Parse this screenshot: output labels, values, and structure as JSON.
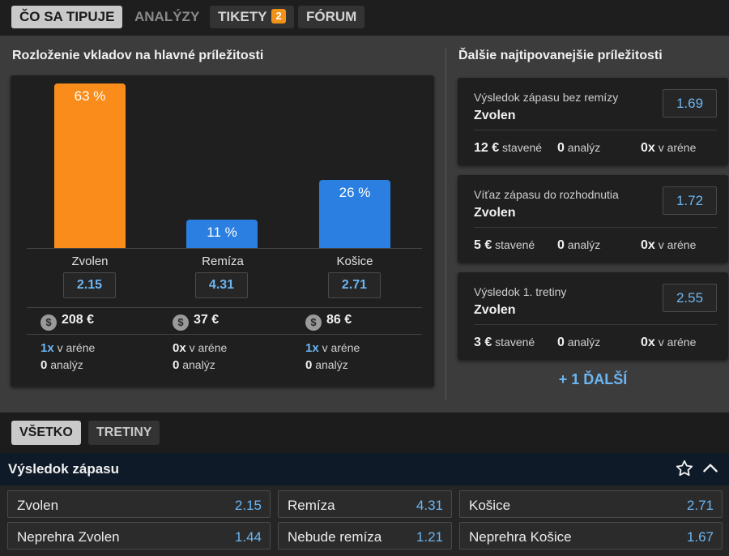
{
  "tabs": [
    {
      "label": "ČO SA TIPUJE"
    },
    {
      "label": "ANALÝZY"
    },
    {
      "label": "TIKETY",
      "badge": "2"
    },
    {
      "label": "FÓRUM"
    }
  ],
  "left_title": "Rozloženie vkladov na hlavné príležitosti",
  "right_title": "Ďalšie najtipovanejšie príležitosti",
  "distribution": [
    {
      "percent_label": "63 %",
      "percent": 63,
      "name": "Zvolen",
      "odds": "2.15",
      "stake": "208 €",
      "arena_count": "1x",
      "arena_label": "v aréne",
      "analyses_count": "0",
      "analyses_label": "analýz",
      "color": "#f98c1a"
    },
    {
      "percent_label": "11 %",
      "percent": 11,
      "name": "Remíza",
      "odds": "4.31",
      "stake": "37 €",
      "arena_count": "0x",
      "arena_label": "v aréne",
      "analyses_count": "0",
      "analyses_label": "analýz",
      "color": "#2a7fe0"
    },
    {
      "percent_label": "26 %",
      "percent": 26,
      "name": "Košice",
      "odds": "2.71",
      "stake": "86 €",
      "arena_count": "1x",
      "arena_label": "v aréne",
      "analyses_count": "0",
      "analyses_label": "analýz",
      "color": "#2a7fe0"
    }
  ],
  "opportunities": [
    {
      "title": "Výsledok zápasu bez remízy",
      "team": "Zvolen",
      "odds": "1.69",
      "stake": "12 €",
      "stake_label": "stavené",
      "analyses": "0",
      "analyses_label": "analýz",
      "arena": "0x",
      "arena_label": "v aréne"
    },
    {
      "title": "Víťaz zápasu do rozhodnutia",
      "team": "Zvolen",
      "odds": "1.72",
      "stake": "5 €",
      "stake_label": "stavené",
      "analyses": "0",
      "analyses_label": "analýz",
      "arena": "0x",
      "arena_label": "v aréne"
    },
    {
      "title": "Výsledok 1. tretiny",
      "team": "Zvolen",
      "odds": "2.55",
      "stake": "3 €",
      "stake_label": "stavené",
      "analyses": "0",
      "analyses_label": "analýz",
      "arena": "0x",
      "arena_label": "v aréne"
    }
  ],
  "more_label": "+ 1 ĎALŠÍ",
  "filters": [
    {
      "label": "VŠETKO"
    },
    {
      "label": "TRETINY"
    }
  ],
  "market": {
    "title": "Výsledok zápasu",
    "rows": [
      [
        {
          "label": "Zvolen",
          "odds": "2.15"
        },
        {
          "label": "Remíza",
          "odds": "4.31"
        },
        {
          "label": "Košice",
          "odds": "2.71"
        }
      ],
      [
        {
          "label": "Neprehra Zvolen",
          "odds": "1.44"
        },
        {
          "label": "Nebude remíza",
          "odds": "1.21"
        },
        {
          "label": "Neprehra Košice",
          "odds": "1.67"
        }
      ]
    ]
  }
}
